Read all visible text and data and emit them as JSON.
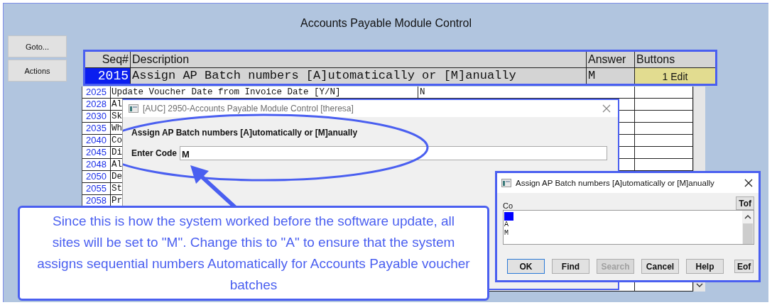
{
  "window": {
    "title": "Accounts Payable Module Control"
  },
  "side_buttons": [
    "Goto...",
    "Actions"
  ],
  "table": {
    "columns": [
      "Seq#",
      "Description",
      "Answer",
      "Buttons"
    ],
    "current_row": {
      "seq": "2015",
      "description": "Assign AP Batch numbers [A]utomatically or [M]anually",
      "answer": "M",
      "button": "1 Edit"
    },
    "rows": [
      {
        "seq": "2025",
        "description": "Update Voucher Date from Invoice Date [Y/N]",
        "answer": "N"
      },
      {
        "seq": "2028",
        "description": "Al"
      },
      {
        "seq": "2030",
        "description": "Sk"
      },
      {
        "seq": "2035",
        "description": "Wh"
      },
      {
        "seq": "2040",
        "description": "Co"
      },
      {
        "seq": "2045",
        "description": "Di"
      },
      {
        "seq": "2048",
        "description": "Al"
      },
      {
        "seq": "2050",
        "description": "De"
      },
      {
        "seq": "2055",
        "description": "St"
      },
      {
        "seq": "2058",
        "description": "Pr"
      }
    ]
  },
  "edit_dialog": {
    "title": "[AUC] 2950-Accounts Payable Module Control [theresa]",
    "prompt": "Assign AP Batch numbers [A]utomatically or [M]anually",
    "field_label": "Enter Code",
    "value": "M"
  },
  "lookup_dialog": {
    "title": "Assign AP Batch numbers [A]utomatically or [M]anually",
    "column": "Co",
    "top_button": "Tof",
    "items": [
      {
        "selected": true
      },
      {
        "label": "A",
        "selected": false
      },
      {
        "label": "M",
        "selected": false
      }
    ],
    "buttons": [
      {
        "label": "OK",
        "disabled": false
      },
      {
        "label": "Find",
        "disabled": false
      },
      {
        "label": "Search",
        "disabled": true
      },
      {
        "label": "Cancel",
        "disabled": false
      },
      {
        "label": "Help",
        "disabled": false
      }
    ],
    "end_button": "Eof"
  },
  "callout": {
    "text": "Since this is how the system worked before the software update, all sites will be set to \"M\". Change this to \"A\" to ensure that the system assigns sequential numbers Automatically for Accounts Payable voucher batches"
  }
}
